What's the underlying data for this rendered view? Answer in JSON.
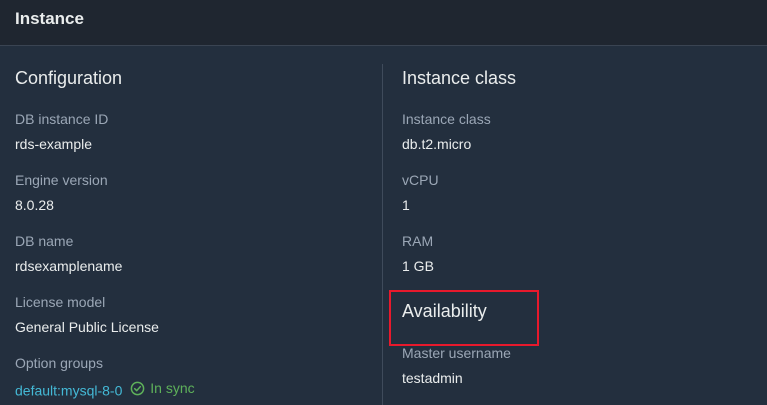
{
  "header": {
    "title": "Instance"
  },
  "configuration": {
    "title": "Configuration",
    "items": [
      {
        "label": "DB instance ID",
        "value": "rds-example"
      },
      {
        "label": "Engine version",
        "value": "8.0.28"
      },
      {
        "label": "DB name",
        "value": "rdsexamplename"
      },
      {
        "label": "License model",
        "value": "General Public License"
      }
    ],
    "option_groups": {
      "label": "Option groups",
      "link": "default:mysql-8-0",
      "status": "In sync"
    }
  },
  "instance_class": {
    "title": "Instance class",
    "items": [
      {
        "label": "Instance class",
        "value": "db.t2.micro"
      },
      {
        "label": "vCPU",
        "value": "1"
      },
      {
        "label": "RAM",
        "value": "1 GB"
      }
    ]
  },
  "availability": {
    "title": "Availability",
    "master_username": {
      "label": "Master username",
      "value": "testadmin"
    }
  },
  "colors": {
    "background": "#232f3e",
    "link": "#44b9d6",
    "status_ok": "#5eb15a",
    "highlight": "#e8192c"
  }
}
